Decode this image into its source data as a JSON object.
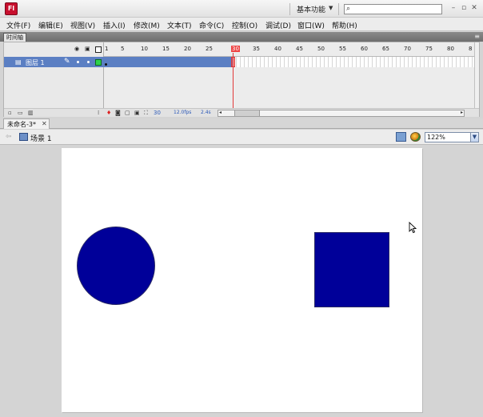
{
  "app": {
    "logo": "Fl",
    "workspace": "基本功能",
    "search_placeholder": "",
    "icons": [
      "search-icon",
      "minimize-icon",
      "restore-icon",
      "close-icon"
    ]
  },
  "menu": [
    "文件(F)",
    "编辑(E)",
    "视图(V)",
    "插入(I)",
    "修改(M)",
    "文本(T)",
    "命令(C)",
    "控制(O)",
    "调试(D)",
    "窗口(W)",
    "帮助(H)"
  ],
  "timeline": {
    "tab_label": "时间轴",
    "layer_name": "图层 1",
    "ruler": [
      "1",
      "5",
      "10",
      "15",
      "20",
      "25",
      "30",
      "35",
      "40",
      "45",
      "50",
      "55",
      "60",
      "65",
      "70",
      "75",
      "80",
      "8"
    ],
    "current_frame": "30",
    "fps": "12.0fps",
    "elapsed": "2.4s"
  },
  "document": {
    "tab_label": "未命名-3*",
    "scene_label": "场景 1",
    "zoom": "122%"
  },
  "stage": {
    "circle_color": "#000099",
    "square_color": "#000099",
    "background": "#ffffff"
  }
}
